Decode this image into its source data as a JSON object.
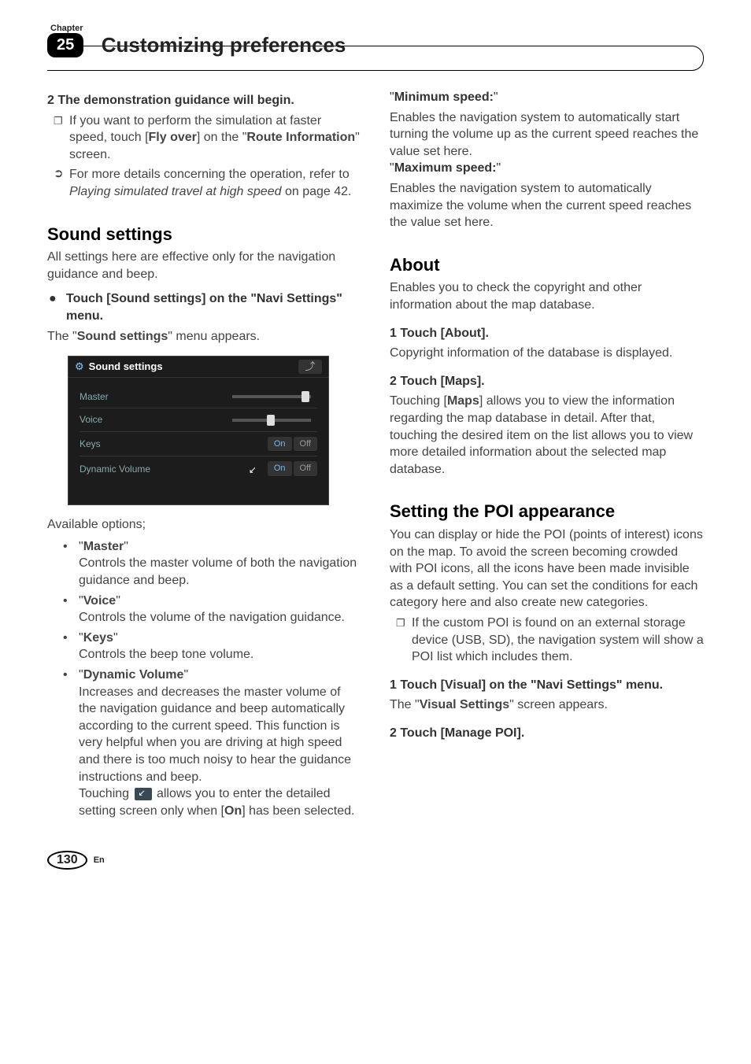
{
  "header": {
    "chapter_label": "Chapter",
    "chapter_number": "25",
    "title": "Customizing preferences"
  },
  "left": {
    "step2": "2    The demonstration guidance will begin.",
    "note1_a": "If you want to perform the simulation at faster speed, touch [",
    "note1_b": "Fly over",
    "note1_c": "] on the \"",
    "note1_d": "Route Information",
    "note1_e": "\" screen.",
    "note2_a": "For more details concerning the operation, refer to ",
    "note2_b": "Playing simulated travel at high speed",
    "note2_c": " on page 42.",
    "sound_title": "Sound settings",
    "sound_intro": "All settings here are effective only for the navigation guidance and beep.",
    "sound_act_a": "Touch [Sound settings] on the \"Navi Settings\" menu.",
    "sound_act_2a": "The \"",
    "sound_act_2b": "Sound settings",
    "sound_act_2c": "\" menu appears.",
    "ss": {
      "title": "Sound settings",
      "rows": {
        "master": "Master",
        "voice": "Voice",
        "keys": "Keys",
        "dynvol": "Dynamic Volume"
      },
      "on": "On",
      "off": "Off"
    },
    "avail": "Available options;",
    "opt_master_t": "Master",
    "opt_master_d": "Controls the master volume of both the navigation guidance and beep.",
    "opt_voice_t": "Voice",
    "opt_voice_d": "Controls the volume of the navigation guidance.",
    "opt_keys_t": "Keys",
    "opt_keys_d": "Controls the beep tone volume.",
    "opt_dyn_t": "Dynamic Volume",
    "opt_dyn_d": "Increases and decreases the master volume of the navigation guidance and beep automatically according to the current speed. This function is very helpful when you are driving at high speed and there is too much noisy to hear the guidance instructions and beep.",
    "opt_dyn_e1": "Touching ",
    "opt_dyn_e2": " allows you to enter the detailed setting screen only when [",
    "opt_dyn_e3": "On",
    "opt_dyn_e4": "] has been selected."
  },
  "right": {
    "min_t": "Minimum speed:",
    "min_d": "Enables the navigation system to automatically start turning the volume up as the current speed reaches the value set here.",
    "max_t": "Maximum speed:",
    "max_d": "Enables the navigation system to automatically maximize the volume when the current speed reaches the value set here.",
    "about_title": "About",
    "about_intro": "Enables you to check the copyright and other information about the map database.",
    "about_s1": "1    Touch [About].",
    "about_s1d": "Copyright information of the database is displayed.",
    "about_s2": "2    Touch [Maps].",
    "about_s2d_a": "Touching [",
    "about_s2d_b": "Maps",
    "about_s2d_c": "] allows you to view the information regarding the map database in detail. After that, touching the desired item on the list allows you to view more detailed information about the selected map database.",
    "poi_title": "Setting the POI appearance",
    "poi_intro": "You can display or hide the POI (points of interest) icons on the map. To avoid the screen becoming crowded with POI icons, all the icons have been made invisible as a default setting. You can set the conditions for each category here and also create new categories.",
    "poi_note": "If the custom POI is found on an external storage device (USB, SD), the navigation system will show a POI list which includes them.",
    "poi_s1": "1    Touch [Visual] on the \"Navi Settings\" menu.",
    "poi_s1d_a": "The \"",
    "poi_s1d_b": "Visual Settings",
    "poi_s1d_c": "\" screen appears.",
    "poi_s2": "2    Touch [Manage POI]."
  },
  "footer": {
    "page": "130",
    "lang": "En"
  }
}
